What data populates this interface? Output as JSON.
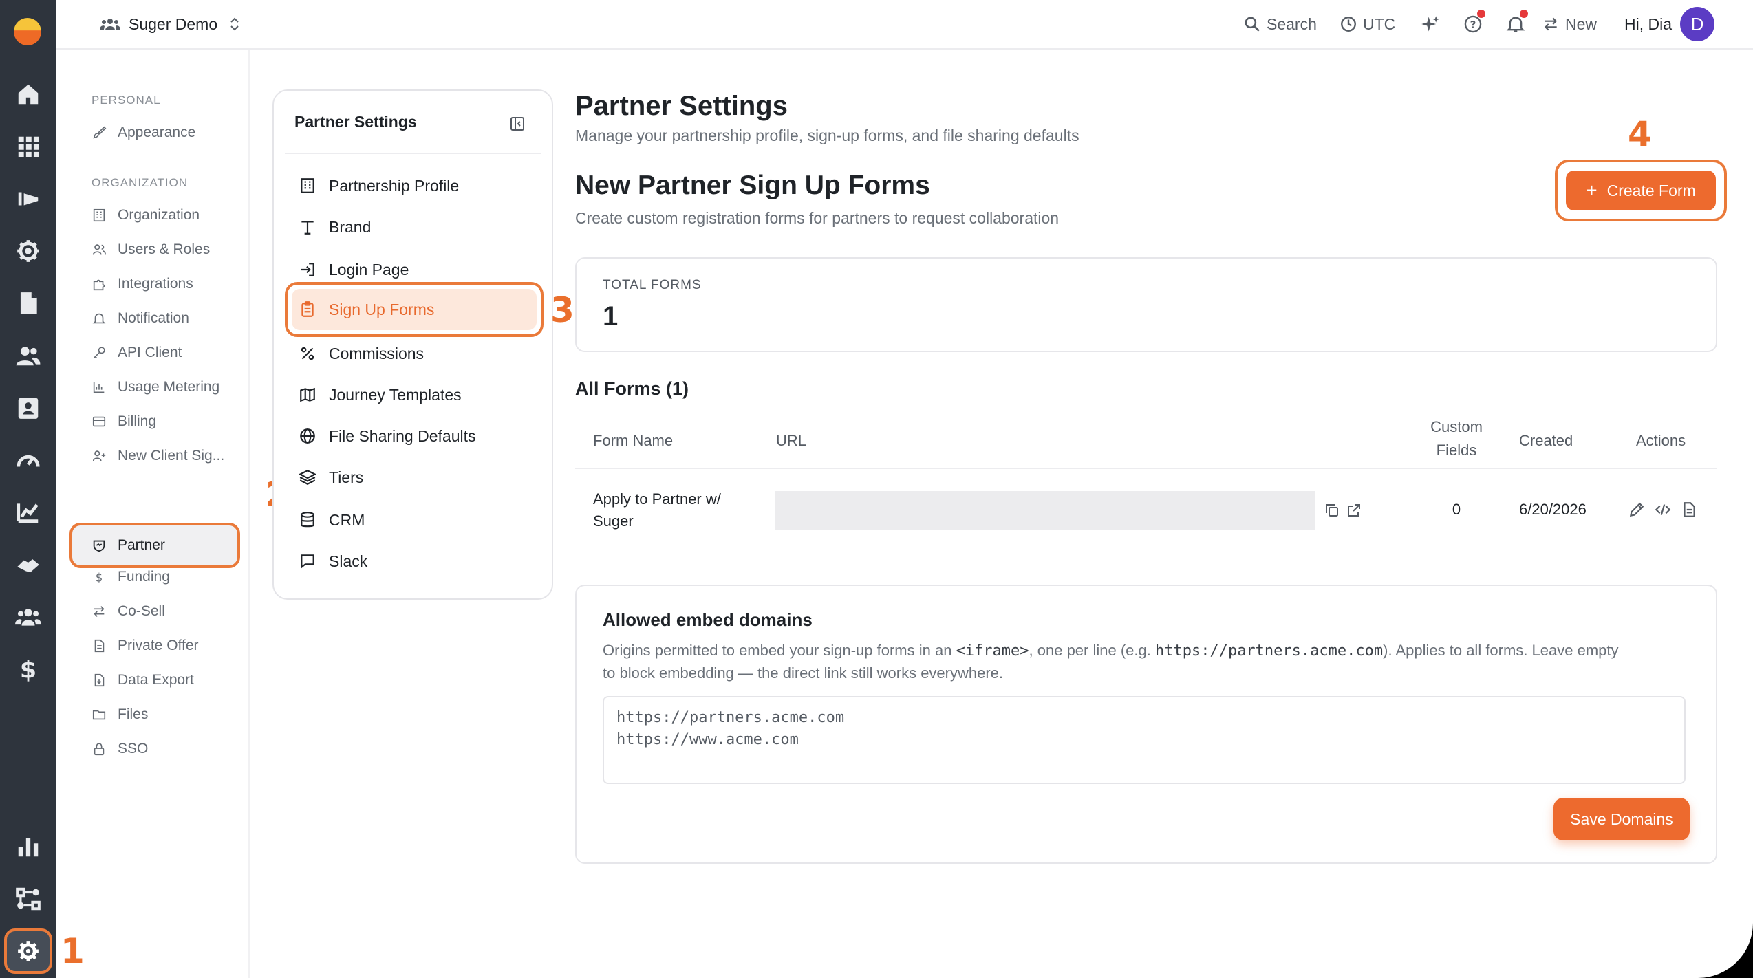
{
  "topbar": {
    "workspace": "Suger Demo",
    "search_label": "Search",
    "timezone": "UTC",
    "new_label": "New",
    "greeting": "Hi, Dia",
    "avatar_initial": "D"
  },
  "markers": {
    "m1": "1",
    "m2": "2",
    "m3": "3",
    "m4": "4"
  },
  "sidenav": {
    "personal_label": "PERSONAL",
    "appearance": "Appearance",
    "organization_label": "ORGANIZATION",
    "items": [
      "Organization",
      "Users & Roles",
      "Integrations",
      "Notification",
      "API Client",
      "Usage Metering",
      "Billing",
      "New Client Sig..."
    ],
    "partner": "Partner",
    "items_after": [
      "Funding",
      "Co-Sell",
      "Private Offer",
      "Data Export",
      "Files",
      "SSO"
    ]
  },
  "panel": {
    "title": "Partner Settings",
    "items": [
      "Partnership Profile",
      "Brand",
      "Login Page",
      "Sign Up Forms",
      "Commissions",
      "Journey Templates",
      "File Sharing Defaults",
      "Tiers",
      "CRM",
      "Slack"
    ]
  },
  "main": {
    "title": "Partner Settings",
    "subtitle": "Manage your partnership profile, sign-up forms, and file sharing defaults",
    "section_title": "New Partner Sign Up Forms",
    "section_sub": "Create custom registration forms for partners to request collaboration",
    "create_button": "Create Form",
    "stat_label": "TOTAL FORMS",
    "stat_value": "1",
    "all_forms": "All Forms (1)",
    "table": {
      "headers": {
        "name": "Form Name",
        "url": "URL",
        "custom_1": "Custom",
        "custom_2": "Fields",
        "created": "Created",
        "actions": "Actions"
      },
      "row": {
        "name_1": "Apply to Partner w/",
        "name_2": "Suger",
        "custom_fields": "0",
        "created": "6/20/2026"
      }
    },
    "embed": {
      "title": "Allowed embed domains",
      "desc_1a": "Origins permitted to embed your sign-up forms in an ",
      "desc_code1": "<iframe>",
      "desc_1b": ", one per line (e.g. ",
      "desc_code2": "https://partners.acme.com",
      "desc_1c": "). Applies to all forms. Leave empty",
      "desc_2": "to block embedding — the direct link still works everywhere.",
      "domains": "https://partners.acme.com\nhttps://www.acme.com",
      "save_button": "Save Domains"
    }
  },
  "colors": {
    "accent": "#ed6a2e",
    "rail": "#2e343d",
    "highlight": "#ea7a3a"
  }
}
